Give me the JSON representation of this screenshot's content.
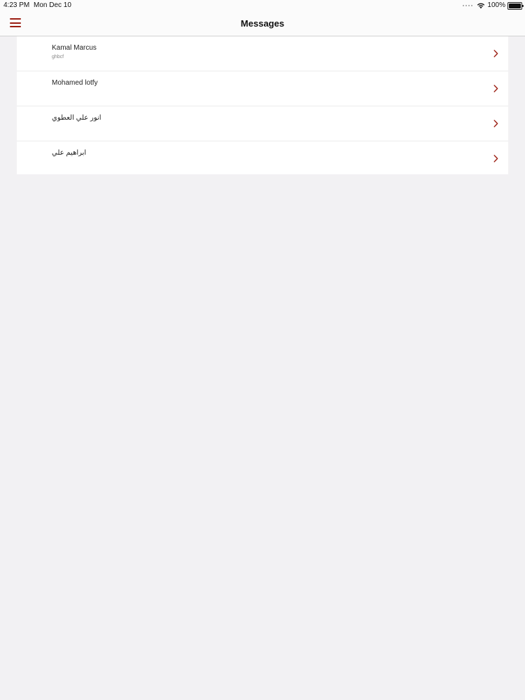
{
  "status_bar": {
    "time": "4:23 PM",
    "date": "Mon Dec 10",
    "battery": "100%"
  },
  "nav": {
    "title": "Messages",
    "menu_icon": "hamburger-menu-icon",
    "accent_color": "#9b1d11"
  },
  "messages": [
    {
      "name": "Kamal Marcus",
      "preview": "ghbcf"
    },
    {
      "name": "Mohamed lotfy",
      "preview": ""
    },
    {
      "name": "انور علي العطوي",
      "preview": ""
    },
    {
      "name": "ابراهيم علي",
      "preview": ""
    }
  ]
}
